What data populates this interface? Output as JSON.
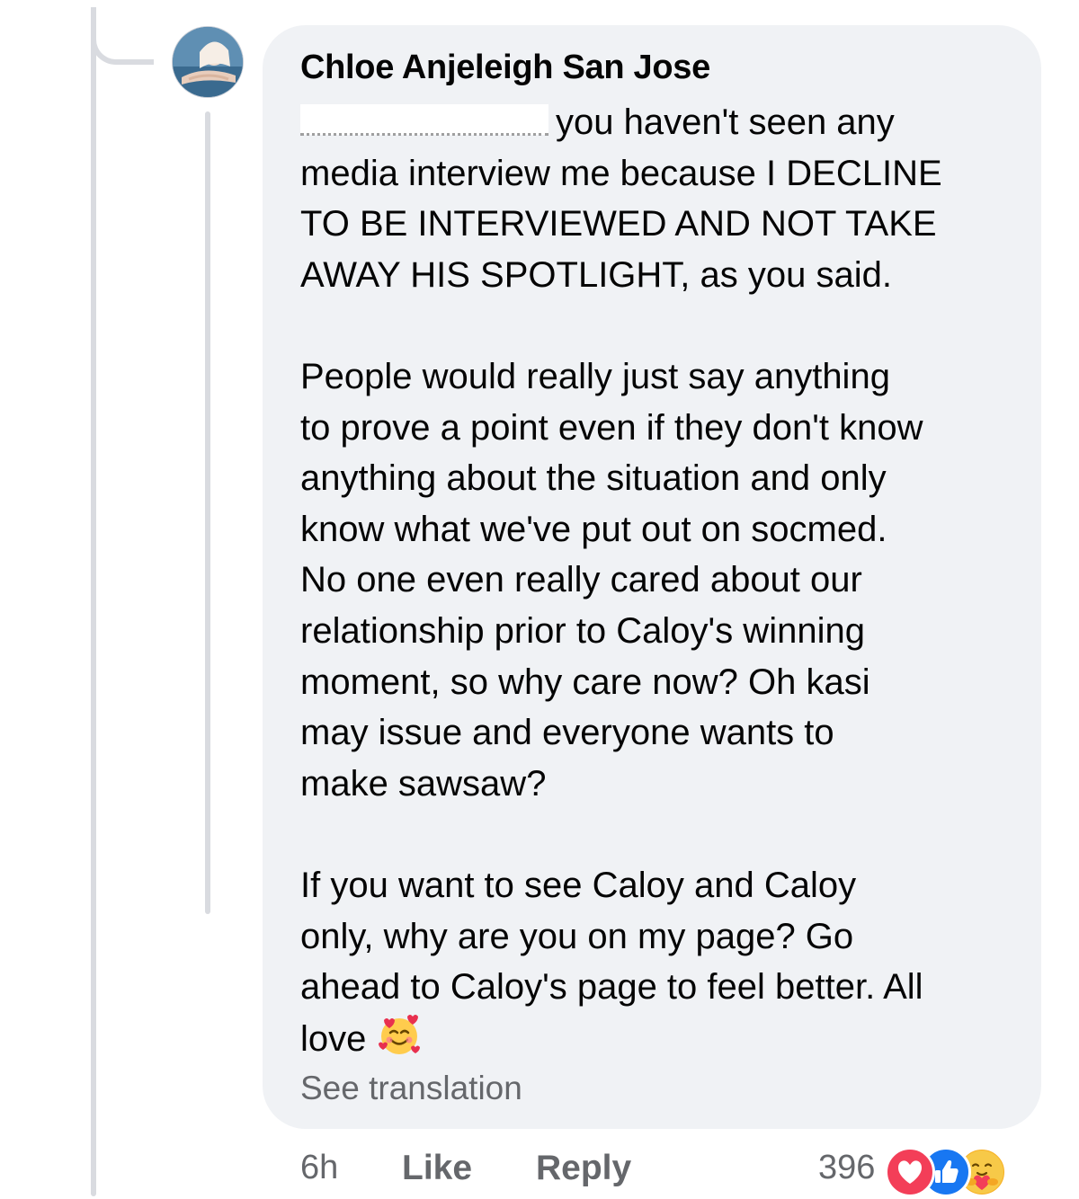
{
  "comment": {
    "author": "Chloe Anjeleigh San Jose",
    "first_line": "you haven't seen any",
    "paragraph1_rest": [
      "media interview me because I DECLINE",
      "TO BE INTERVIEWED AND NOT TAKE",
      "AWAY HIS SPOTLIGHT, as you said."
    ],
    "paragraph2": [
      "People would really just say anything",
      "to prove a point even if they don't know",
      "anything about the situation and only",
      "know what we've put out on socmed.",
      "No one even really cared about our",
      "relationship prior to Caloy's winning",
      "moment, so why care now? Oh kasi",
      "may issue and everyone wants to",
      "make sawsaw?"
    ],
    "paragraph3": [
      "If you want to see Caloy and Caloy",
      "only, why are you on my page? Go",
      "ahead to Caloy's page to feel better. All"
    ],
    "last_line": "love",
    "emoji_icon": "smiling-face-with-hearts-icon",
    "see_translation": "See translation"
  },
  "actions": {
    "time": "6h",
    "like": "Like",
    "reply": "Reply",
    "reaction_count": "396",
    "reaction_icons": [
      "love-reaction-icon",
      "like-reaction-icon",
      "care-reaction-icon"
    ]
  },
  "colors": {
    "bubble": "#f0f2f5",
    "text": "#050505",
    "muted": "#65676b",
    "love": "#f33e58",
    "like": "#1877f2",
    "care": "#f7b125"
  }
}
